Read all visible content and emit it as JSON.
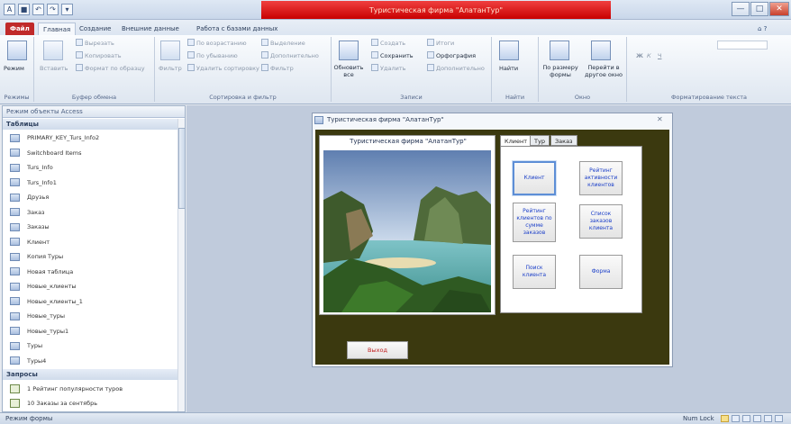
{
  "app": {
    "title": "Туристическая фирма \"АлатанТур\""
  },
  "quick_access": {
    "undo": "↶",
    "redo": "↷",
    "dropdown": "▾",
    "app_icon": "A",
    "save": "■"
  },
  "window_controls": {
    "minimize": "—",
    "maximize": "□",
    "close": "✕"
  },
  "ribbon": {
    "tabs": [
      {
        "label": "Файл"
      },
      {
        "label": "Главная"
      },
      {
        "label": "Создание"
      },
      {
        "label": "Внешние данные"
      },
      {
        "label": "Работа с базами данных"
      }
    ],
    "help": "⌂ ?",
    "groups": {
      "views": {
        "label": "Режимы",
        "view_button": "Режим"
      },
      "clipboard": {
        "label": "Буфер обмена",
        "paste": "Вставить",
        "cut": "Вырезать",
        "copy": "Копировать",
        "format_painter": "Формат по образцу"
      },
      "sort_filter": {
        "label": "Сортировка и фильтр",
        "filter": "Фильтр",
        "ascending": "По возрастанию",
        "descending": "По убыванию",
        "remove_sort": "Удалить сортировку",
        "selection": "Выделение",
        "advanced": "Дополнительно",
        "toggle_filter": "Фильтр"
      },
      "records": {
        "label": "Записи",
        "refresh": "Обновить все",
        "new": "Создать",
        "save": "Сохранить",
        "delete": "Удалить",
        "totals": "Итоги",
        "spelling": "Орфография",
        "more": "Дополнительно"
      },
      "find": {
        "label": "Найти",
        "find": "Найти"
      },
      "window": {
        "label": "Окно",
        "fit_form": "По размеру формы",
        "switch_window": "Перейти в другое окно"
      },
      "text_format": {
        "label": "Форматирование текста",
        "bold": "Ж",
        "italic": "К",
        "underline": "Ч"
      }
    }
  },
  "nav": {
    "header": "Режим объекты Access",
    "sections": [
      {
        "label": "Таблицы",
        "items": [
          "PRIMARY_KEY_Turs_Info2",
          "Switchboard Items",
          "Turs_Info",
          "Turs_Info1",
          "Друзья",
          "Заказ",
          "Заказы",
          "Клиент",
          "Копия Туры",
          "Новая таблица",
          "Новые_клиенты",
          "Новые_клиенты_1",
          "Новые_туры",
          "Новые_туры1",
          "Туры",
          "Туры4"
        ]
      },
      {
        "label": "Запросы",
        "items": [
          "1 Рейтинг популярности туров",
          "10 Заказы за сентябрь"
        ]
      }
    ]
  },
  "form": {
    "window_title": "Туристическая фирма \"АлатанТур\"",
    "close_glyph": "✕",
    "header": "Туристическая фирма \"АлатанТур\"",
    "tabs": [
      {
        "label": "Клиент"
      },
      {
        "label": "Тур"
      },
      {
        "label": "Заказ"
      }
    ],
    "buttons": [
      "Клиент",
      "Рейтинг активности клиентов",
      "Рейтинг клиентов по сумме заказов",
      "Список заказов клиента",
      "Поиск клиента",
      "Форма"
    ],
    "exit": "Выход"
  },
  "status": {
    "left": "Режим формы",
    "num_lock": "Num Lock"
  }
}
